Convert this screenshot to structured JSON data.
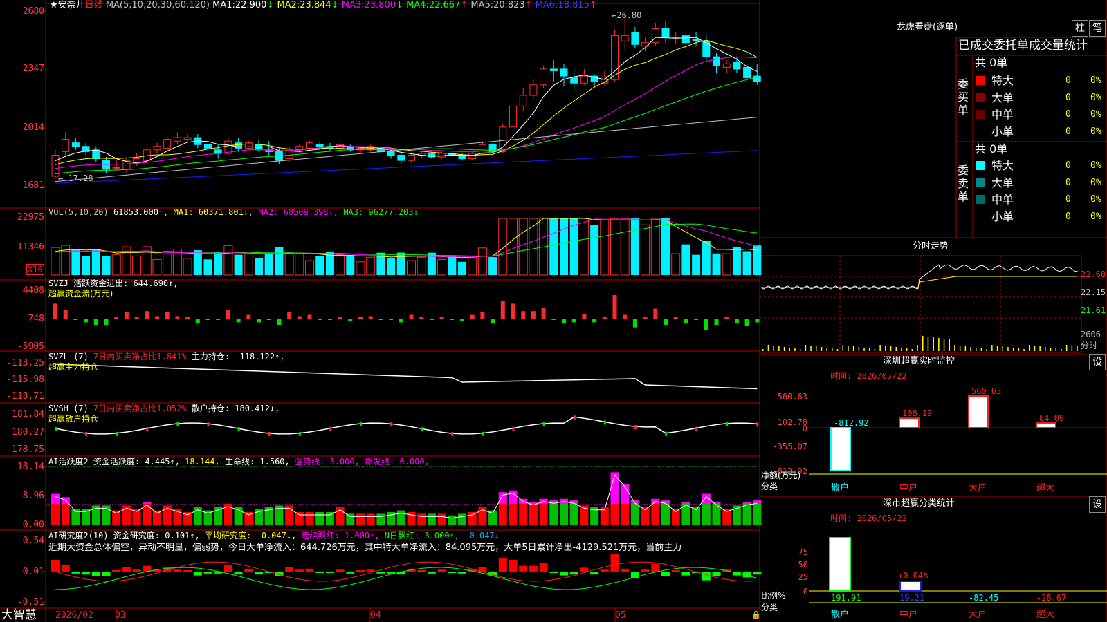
{
  "colors": {
    "up": "#ff2b2b",
    "down": "#00f0ff",
    "ma1": "#ffffff",
    "ma2": "#ffff00",
    "ma3": "#ff00ff",
    "ma4": "#00ff00",
    "ma5": "#c0c0c0",
    "ma6": "#1a1aff",
    "frame": "#b00000"
  },
  "main": {
    "title_star": "★安奈儿",
    "period": "日线",
    "ma_params": "MA(5,10,20,30,60,120)",
    "ma": [
      {
        "label": "MA1:",
        "value": "22.900",
        "arrow": "↓"
      },
      {
        "label": "MA2:",
        "value": "23.844",
        "arrow": "↓"
      },
      {
        "label": "MA3:",
        "value": "23.800",
        "arrow": "↓"
      },
      {
        "label": "MA4:",
        "value": "22.667",
        "arrow": "↑"
      },
      {
        "label": "MA5:",
        "value": "20.823",
        "arrow": "↑"
      },
      {
        "label": "MA6:",
        "value": "18.815",
        "arrow": "↑"
      }
    ],
    "ticks": [
      "2680",
      "2347",
      "2014",
      "1681"
    ],
    "high_label": "26.80",
    "low_label": "17.28"
  },
  "vol": {
    "header": "VOL(5,10,20)",
    "value": "61853.000",
    "arrow": "↑",
    "ma1": "MA1: 60371.801↓",
    "ma2": "MA2: 68509.398↓",
    "ma3": "MA3: 96277.203↓",
    "ticks": [
      "22975",
      "11346"
    ],
    "unit": "X10"
  },
  "svzj": {
    "header": "SVZJ  活跃资金进出: 644.690↑,",
    "sub": "超赢资金流(万元)",
    "ticks": [
      "4408",
      "-748",
      "-5905"
    ]
  },
  "svzl": {
    "header_a": "SVZL (7) ",
    "header_b": "7日内买卖净占比1.841%",
    "header_c": " 主力持仓: -118.122↑,",
    "sub": "超赢主力持仓",
    "ticks": [
      "-113.25",
      "-115.98",
      "-118.71"
    ]
  },
  "svsh": {
    "header_a": "SVSH (7) ",
    "header_b": "7日内买卖净占比1.052%",
    "header_c": " 散户持仓: 180.412↓,",
    "sub": "超赢散户持仓",
    "ticks": [
      "181.84",
      "180.27",
      "178.75"
    ]
  },
  "ai1": {
    "header_a": "AI活跃度2 资金活跃度: 4.445↑, ",
    "header_b": "18.144, ",
    "header_c": "生命线: 1.560, ",
    "header_d": "强势线: 3.000, 爆发线: 6.000,",
    "ticks": [
      "18.14",
      "8.96",
      "0.00"
    ]
  },
  "ai2": {
    "header_a": "AI研究度2(10) 资金研究度: 0.101↑, ",
    "header_b": "平均研究度: -0.047↓, ",
    "header_c": "连续飘红: 1.000↑, ",
    "header_d": "N日飘红: 3.000↑, ",
    "header_e": "-0.047↓",
    "text": "近期大资金总体偏空，异动不明显，偏弱势，今日大单净流入：644.726万元，其中特大单净流入：84.095万元，大单5日累计净出-4129.521万元，当前主力",
    "ticks": [
      "0.54",
      "0.01",
      "-0.51"
    ]
  },
  "bottom": {
    "brand": "大智慧",
    "date": "2026/02",
    "m3": "03",
    "m4": "04",
    "m5": "05"
  },
  "right": {
    "lhkp": "龙虎看盘(逐单)",
    "btn1": "柱",
    "btn2": "笔",
    "header": "已成交委托单成交量统计",
    "buy_label": "委买单",
    "buy_total": "共 0单",
    "sell_label": "委卖单",
    "sell_total": "共 0单",
    "rows": [
      {
        "name": "特大",
        "count": "0",
        "pct": "0%"
      },
      {
        "name": "大单",
        "count": "0",
        "pct": "0%"
      },
      {
        "name": "中单",
        "count": "0",
        "pct": "0%"
      },
      {
        "name": "小单",
        "count": "0",
        "pct": "0%"
      }
    ],
    "buy_colors": [
      "#ff0000",
      "#8b0000",
      "#6b0000",
      "#000000"
    ],
    "sell_colors": [
      "#00ffff",
      "#008b8b",
      "#006b6b",
      "#000000"
    ],
    "intraday_title": "分时走势",
    "intraday_ticks": [
      "22.68",
      "22.15",
      "21.61"
    ],
    "intraday_vol": "2606",
    "intraday_vol_unit": "分时",
    "monitor_title": "深圳超赢实时监控",
    "monitor_time": "时间: 2026/05/22",
    "monitor_ticks": [
      "560.63",
      "102.78",
      "0",
      "-355.07",
      "-812.92"
    ],
    "monitor_axis": "净额(万元)",
    "monitor_cat": "分类",
    "monitor_bars": [
      {
        "name": "散户",
        "value": -812.92,
        "label": "-812.92"
      },
      {
        "name": "中户",
        "value": 168.19,
        "label": "168.19"
      },
      {
        "name": "大户",
        "value": 560.63,
        "label": "560.63"
      },
      {
        "name": "超大",
        "value": 84.09,
        "label": "84.09"
      }
    ],
    "stat_title": "深市超赢分类统计",
    "stat_time": "时间: 2026/05/22",
    "stat_ticks": [
      "75",
      "50",
      "25",
      "0"
    ],
    "stat_axis": "比例%",
    "stat_cat": "分类",
    "stat_pct_label": "+0.04%",
    "stat_bars": [
      {
        "name": "散户",
        "label": "191.91"
      },
      {
        "name": "中户",
        "label": "19.21"
      },
      {
        "name": "大户",
        "label": "-82.45"
      },
      {
        "name": "超大",
        "label": "-28.67"
      }
    ],
    "set": "设"
  },
  "chart_data": [
    {
      "type": "candlestick",
      "title": "★安奈儿 日线",
      "note": "price axis ticks 2680/2347/2014/1681 (x0.01 yuan)",
      "ylim": [
        16.81,
        26.8
      ],
      "candles": [
        [
          17.4,
          18.6,
          17.3,
          18.9
        ],
        [
          18.8,
          19.5,
          18.5,
          19.9
        ],
        [
          19.3,
          19.1,
          18.9,
          19.6
        ],
        [
          19.1,
          18.8,
          18.6,
          19.3
        ],
        [
          18.9,
          18.4,
          18.2,
          19.1
        ],
        [
          18.3,
          17.8,
          17.6,
          18.5
        ],
        [
          17.9,
          17.9,
          17.7,
          18.3
        ],
        [
          17.8,
          18.3,
          17.6,
          18.5
        ],
        [
          18.2,
          18.4,
          18.0,
          18.7
        ],
        [
          18.3,
          18.9,
          18.1,
          19.2
        ],
        [
          18.9,
          19.1,
          18.7,
          19.3
        ],
        [
          19.0,
          19.5,
          18.8,
          19.7
        ],
        [
          19.4,
          19.6,
          19.2,
          19.9
        ],
        [
          19.5,
          19.6,
          19.3,
          19.8
        ],
        [
          19.6,
          19.2,
          19.0,
          19.8
        ],
        [
          19.2,
          19.0,
          18.8,
          19.4
        ],
        [
          18.9,
          18.7,
          18.4,
          19.2
        ],
        [
          18.7,
          19.4,
          18.6,
          19.6
        ],
        [
          19.3,
          19.0,
          18.8,
          19.6
        ],
        [
          19.0,
          19.3,
          18.9,
          19.4
        ],
        [
          19.2,
          18.9,
          18.8,
          19.5
        ],
        [
          18.9,
          18.8,
          18.6,
          19.4
        ],
        [
          18.8,
          18.3,
          18.1,
          19.0
        ],
        [
          18.4,
          18.9,
          18.2,
          19.1
        ],
        [
          18.9,
          19.1,
          18.7,
          19.2
        ],
        [
          19.0,
          19.3,
          18.9,
          19.4
        ],
        [
          19.2,
          19.1,
          18.9,
          19.4
        ],
        [
          19.1,
          19.0,
          18.8,
          19.3
        ],
        [
          19.0,
          19.2,
          18.8,
          19.6
        ],
        [
          19.1,
          18.9,
          18.8,
          19.2
        ],
        [
          18.9,
          19.0,
          18.7,
          19.1
        ],
        [
          18.9,
          19.1,
          18.8,
          19.2
        ],
        [
          19.0,
          18.8,
          18.7,
          19.1
        ],
        [
          18.8,
          18.6,
          18.4,
          18.9
        ],
        [
          18.6,
          18.3,
          18.1,
          18.7
        ],
        [
          18.3,
          18.6,
          18.2,
          18.7
        ],
        [
          18.6,
          18.7,
          18.4,
          18.8
        ],
        [
          18.7,
          18.5,
          18.4,
          18.8
        ],
        [
          18.5,
          18.7,
          18.4,
          18.8
        ],
        [
          18.7,
          18.6,
          18.5,
          18.8
        ],
        [
          18.6,
          18.4,
          18.3,
          18.7
        ],
        [
          18.4,
          18.7,
          18.3,
          18.8
        ],
        [
          18.7,
          19.2,
          18.6,
          19.4
        ],
        [
          19.2,
          18.8,
          18.7,
          19.3
        ],
        [
          18.8,
          20.2,
          18.7,
          20.4
        ],
        [
          20.2,
          21.4,
          20.0,
          21.8
        ],
        [
          21.4,
          22.0,
          21.1,
          22.4
        ],
        [
          22.0,
          22.6,
          21.8,
          22.9
        ],
        [
          22.6,
          23.5,
          22.4,
          23.7
        ],
        [
          23.5,
          23.4,
          22.8,
          24.0
        ],
        [
          23.5,
          23.1,
          22.5,
          23.8
        ],
        [
          23.0,
          22.7,
          22.3,
          23.5
        ],
        [
          22.7,
          23.1,
          22.6,
          23.5
        ],
        [
          23.1,
          22.8,
          22.4,
          23.2
        ],
        [
          22.7,
          22.9,
          22.6,
          23.4
        ],
        [
          22.9,
          25.4,
          22.8,
          25.7
        ],
        [
          25.1,
          25.4,
          24.6,
          26.8
        ],
        [
          25.6,
          24.9,
          24.7,
          25.9
        ],
        [
          24.8,
          25.0,
          24.5,
          25.3
        ],
        [
          25.0,
          25.8,
          24.8,
          26.1
        ],
        [
          25.8,
          25.3,
          25.0,
          26.2
        ],
        [
          25.3,
          25.3,
          24.9,
          25.6
        ],
        [
          25.4,
          25.0,
          24.6,
          25.7
        ],
        [
          25.2,
          25.1,
          24.8,
          25.6
        ],
        [
          25.1,
          24.2,
          23.9,
          25.5
        ],
        [
          24.2,
          23.7,
          23.3,
          24.4
        ],
        [
          23.6,
          23.8,
          23.3,
          24.0
        ],
        [
          23.9,
          23.5,
          23.3,
          24.2
        ],
        [
          23.6,
          23.0,
          22.7,
          23.8
        ],
        [
          23.1,
          22.8,
          22.6,
          23.8
        ]
      ]
    },
    {
      "type": "bar",
      "title": "深圳超赢实时监控",
      "xlabel": "分类",
      "ylabel": "净额(万元)",
      "categories": [
        "散户",
        "中户",
        "大户",
        "超大"
      ],
      "values": [
        -812.92,
        168.19,
        560.63,
        84.09
      ]
    },
    {
      "type": "bar",
      "title": "深市超赢分类统计",
      "xlabel": "分类",
      "ylabel": "比例%",
      "categories": [
        "散户",
        "中户",
        "大户",
        "超大"
      ],
      "values": [
        191.91,
        19.21,
        -82.45,
        -28.67
      ]
    }
  ]
}
